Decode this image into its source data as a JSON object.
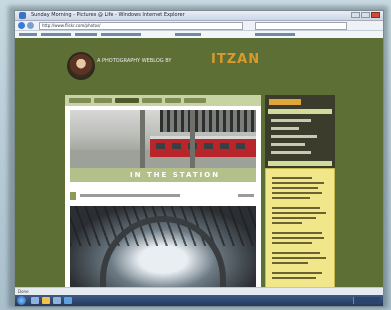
{
  "browser": {
    "window_title": "Sunday Morning - Pictures @ Life - Windows Internet Explorer",
    "address": "http://www.flickr.com/photos/",
    "status_text": "Done"
  },
  "site": {
    "title_line": "A PHOTOGRAPHY WEBLOG BY",
    "name": "ITZAN",
    "photo1_caption": "IN THE STATION"
  },
  "colors": {
    "page_bg": "#5e6f36",
    "accent": "#d99a2b",
    "sidebar_bg": "#3b3c2c",
    "note_bg": "#f2e68a"
  }
}
